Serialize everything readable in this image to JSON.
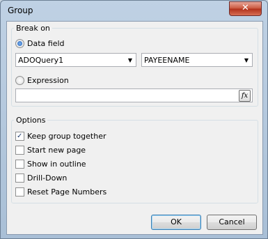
{
  "window": {
    "title": "Group",
    "close_glyph": "✕"
  },
  "break_on": {
    "legend": "Break on",
    "data_field_label": "Data field",
    "dataset_value": "ADOQuery1",
    "field_value": "PAYEENAME",
    "expression_label": "Expression",
    "expression_value": "",
    "fx_glyph": "fx",
    "combo_arrow": "▼"
  },
  "options": {
    "legend": "Options",
    "items": [
      {
        "label": "Keep group together",
        "checked": true
      },
      {
        "label": "Start new page",
        "checked": false
      },
      {
        "label": "Show in outline",
        "checked": false
      },
      {
        "label": "Drill-Down",
        "checked": false
      },
      {
        "label": "Reset Page Numbers",
        "checked": false
      }
    ]
  },
  "buttons": {
    "ok": "OK",
    "cancel": "Cancel"
  }
}
